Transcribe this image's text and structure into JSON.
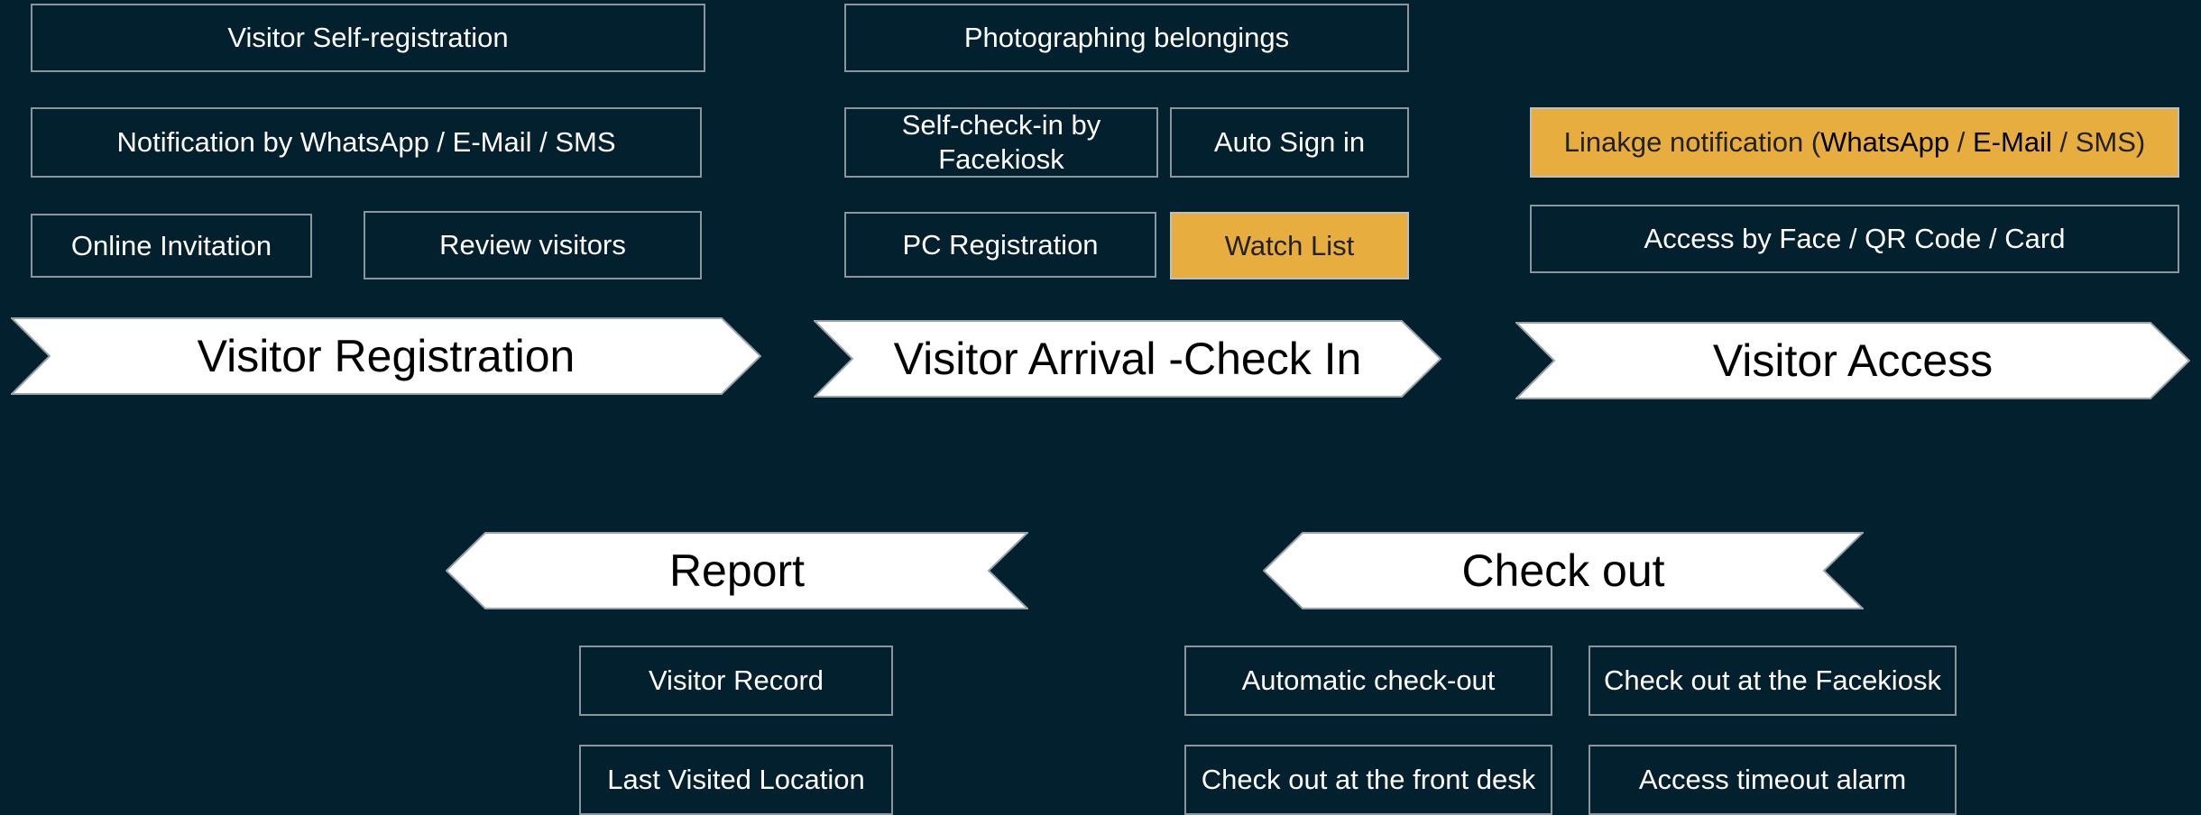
{
  "colors": {
    "background": "#03202e",
    "box_border": "#8c959b",
    "highlight": "#e8ad3f",
    "stage_fill": "#ffffff"
  },
  "registration": {
    "stage": "Visitor Registration",
    "self_registration": "Visitor Self-registration",
    "notification": "Notification by WhatsApp / E-Mail / SMS",
    "online_invitation": "Online Invitation",
    "review_visitors": "Review visitors"
  },
  "arrival": {
    "stage": "Visitor Arrival -Check In",
    "photographing": "Photographing belongings",
    "self_checkin": "Self-check-in by Facekiosk",
    "auto_sign_in": "Auto Sign in",
    "pc_registration": "PC Registration",
    "watch_list": "Watch List"
  },
  "access": {
    "stage": "Visitor Access",
    "linkage": {
      "prefix": "Linakge notification (",
      "whatsapp": "WhatsApp",
      "sep1": " / ",
      "email": "E-Mail",
      "sep2": " / ",
      "sms": "SMS",
      "suffix": ")"
    },
    "access_methods": "Access by Face / QR Code / Card"
  },
  "report": {
    "stage": "Report",
    "visitor_record": "Visitor Record",
    "last_visited": "Last Visited Location"
  },
  "checkout": {
    "stage": "Check out",
    "automatic": "Automatic check-out",
    "facekiosk": "Check out at the Facekiosk",
    "front_desk": "Check out at the front desk",
    "timeout_alarm": "Access timeout alarm"
  }
}
